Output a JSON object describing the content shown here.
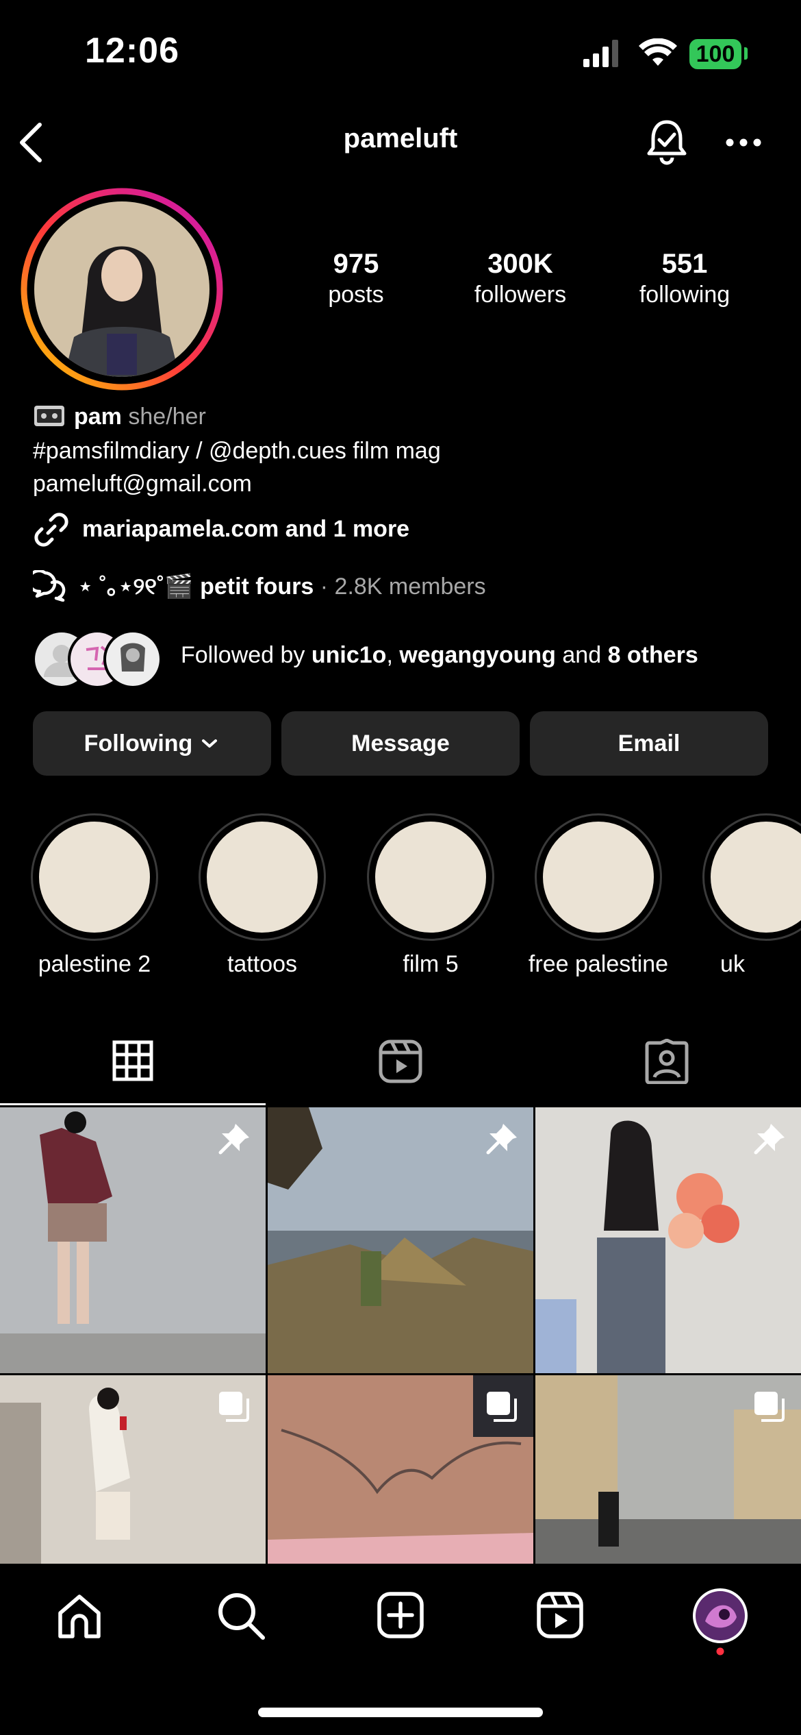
{
  "status_bar": {
    "time": "12:06",
    "battery": "100"
  },
  "header": {
    "username": "pameluft"
  },
  "stats": [
    {
      "value": "975",
      "label": "posts"
    },
    {
      "value": "300K",
      "label": "followers"
    },
    {
      "value": "551",
      "label": "following"
    }
  ],
  "bio": {
    "name": "pam",
    "pronouns": "she/her",
    "line1": "#pamsfilmdiary / @depth.cues film mag",
    "line2": "pameluft@gmail.com",
    "link": "mariapamela.com and 1 more",
    "channel_name": "⋆ ˚｡⋆୨୧˚🎬 petit fours",
    "channel_sep": "·",
    "channel_members": "2.8K members",
    "followed_prefix": "Followed by",
    "followed_user1": "unic1o",
    "followed_comma": ",",
    "followed_user2": "wegangyoung",
    "followed_and": "and",
    "followed_others": "8 others"
  },
  "buttons": {
    "following": "Following",
    "message": "Message",
    "email": "Email"
  },
  "highlights": [
    "palestine 2",
    "tattoos",
    "film 5",
    "free palestine",
    "uk"
  ],
  "tabs": [
    "grid-icon",
    "reels-icon",
    "tagged-icon"
  ],
  "colors": {
    "background": "#000000",
    "button": "#262626",
    "highlight_fill": "#ebe3d5",
    "battery": "#33c759",
    "notify_dot": "#ff3040"
  }
}
